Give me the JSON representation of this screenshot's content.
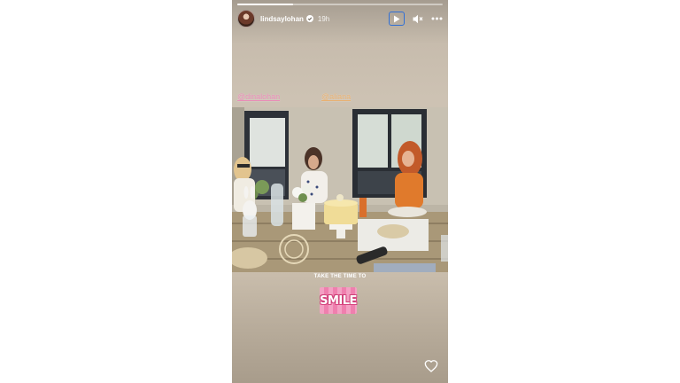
{
  "story": {
    "username": "lindsaylohan",
    "time": "19h",
    "progress_fraction": 0.27,
    "tags": [
      "@dinalohan",
      "@aliana"
    ],
    "caption": "TAKE THE TIME TO",
    "sticker_text": "SMILE"
  },
  "icons": {
    "avatar": "avatar",
    "verified": "verified-badge-icon",
    "play": "play-icon",
    "mute": "speaker-muted-icon",
    "more": "more-horizontal-icon",
    "like": "heart-icon"
  },
  "colors": {
    "tag_1": "#e98bb6",
    "tag_2": "#e8b070",
    "focus_ring": "#2f6fd6",
    "sticker": "#ef7fae"
  }
}
